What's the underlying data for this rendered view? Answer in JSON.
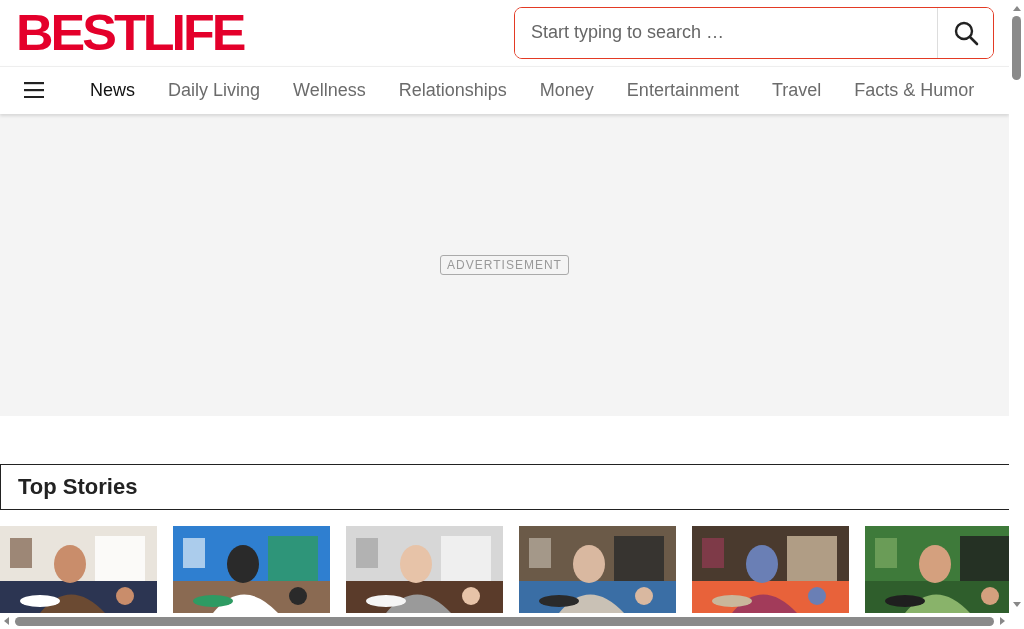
{
  "logo": "BESTLIFE",
  "search": {
    "placeholder": "Start typing to search …"
  },
  "nav": [
    {
      "label": "News",
      "selected": true
    },
    {
      "label": "Daily Living",
      "selected": false
    },
    {
      "label": "Wellness",
      "selected": false
    },
    {
      "label": "Relationships",
      "selected": false
    },
    {
      "label": "Money",
      "selected": false
    },
    {
      "label": "Entertainment",
      "selected": false
    },
    {
      "label": "Travel",
      "selected": false
    },
    {
      "label": "Facts & Humor",
      "selected": false
    }
  ],
  "ad": {
    "label": "ADVERTISEMENT"
  },
  "section": {
    "title": "Top Stories"
  }
}
